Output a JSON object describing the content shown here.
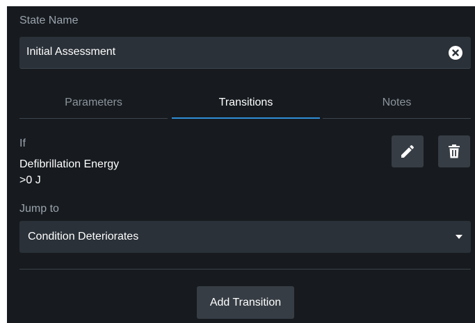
{
  "state_name": {
    "label": "State Name",
    "value": "Initial Assessment",
    "clear_icon": "close-circle-icon"
  },
  "tabs": [
    {
      "label": "Parameters",
      "active": false
    },
    {
      "label": "Transitions",
      "active": true
    },
    {
      "label": "Notes",
      "active": false
    }
  ],
  "transition": {
    "if_label": "If",
    "condition_title": "Defibrillation Energy",
    "condition_value": ">0 J",
    "edit_icon": "pencil-icon",
    "delete_icon": "trash-icon"
  },
  "jump_to": {
    "label": "Jump to",
    "selected": "Condition Deteriorates",
    "caret_icon": "caret-down-icon"
  },
  "add_transition_label": "Add Transition",
  "colors": {
    "background": "#171b1f",
    "field": "#2a3138",
    "button": "#363d44",
    "accent": "#2f8fd8"
  }
}
